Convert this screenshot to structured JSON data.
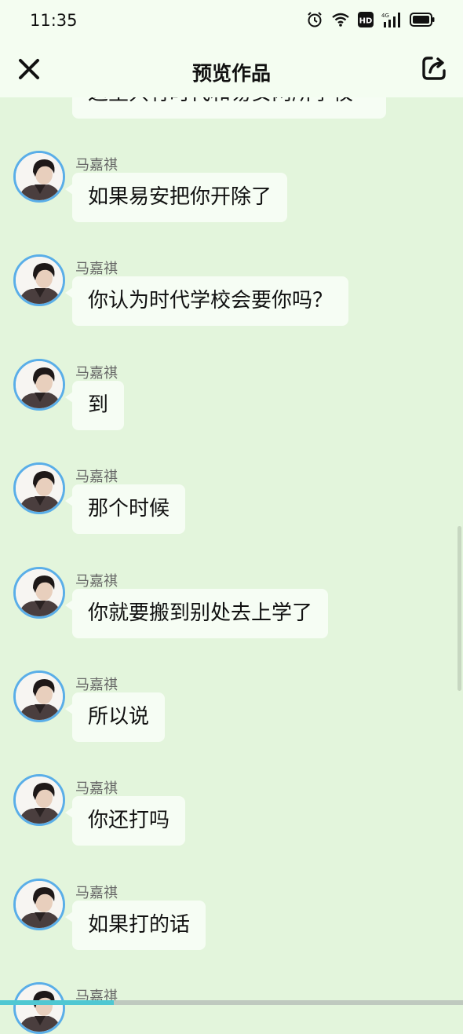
{
  "status_bar": {
    "time": "11:35",
    "icons": [
      "alarm-icon",
      "wifi-icon",
      "hd-icon",
      "4g-signal-icon",
      "battery-icon"
    ],
    "hd_label": "HD",
    "network_label": "4G"
  },
  "header": {
    "title": "预览作品",
    "close_icon": "close-icon",
    "share_icon": "share-icon"
  },
  "colors": {
    "background": "#e3f5dc",
    "bubble": "#f6fdf4",
    "avatar_ring": "#5aaee8",
    "progress_fill": "#4fc7d2"
  },
  "partial_message": {
    "text": "这里只有时代和易安两所学校"
  },
  "messages": [
    {
      "sender": "马嘉祺",
      "text": "如果易安把你开除了"
    },
    {
      "sender": "马嘉祺",
      "text": "你认为时代学校会要你吗？"
    },
    {
      "sender": "马嘉祺",
      "text": "到"
    },
    {
      "sender": "马嘉祺",
      "text": "那个时候"
    },
    {
      "sender": "马嘉祺",
      "text": "你就要搬到别处去上学了"
    },
    {
      "sender": "马嘉祺",
      "text": "所以说"
    },
    {
      "sender": "马嘉祺",
      "text": "你还打吗"
    },
    {
      "sender": "马嘉祺",
      "text": "如果打的话"
    },
    {
      "sender": "马嘉祺",
      "text": ""
    }
  ],
  "progress": {
    "fraction": 0.245
  }
}
